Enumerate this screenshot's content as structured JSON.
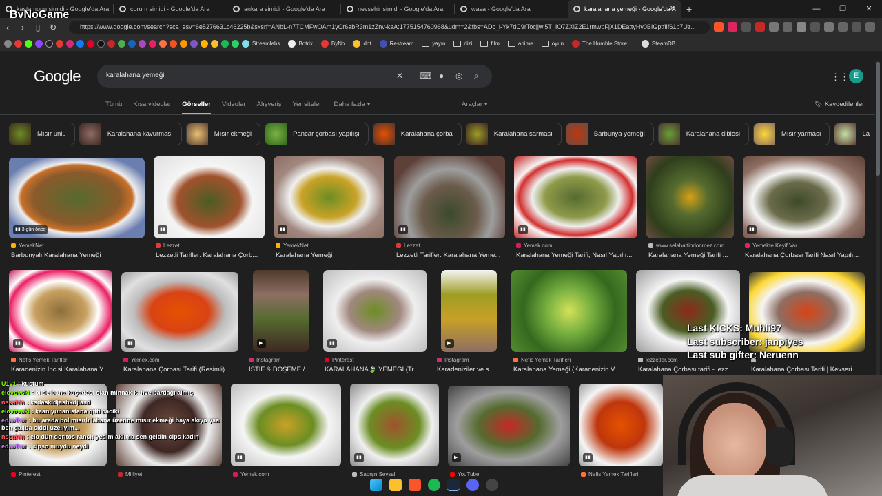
{
  "browser": {
    "tabs": [
      {
        "label": "kastamonu simidi - Google'da Ara",
        "active": false
      },
      {
        "label": "çorum simidi - Google'da Ara",
        "active": false
      },
      {
        "label": "ankara simidi - Google'da Ara",
        "active": false
      },
      {
        "label": "nevsehir simidi - Google'da Ara",
        "active": false
      },
      {
        "label": "wasa - Google'da Ara",
        "active": false
      },
      {
        "label": "karalahana yemeği - Google'da A",
        "active": true
      }
    ],
    "url": "https://www.google.com/search?sca_esv=6e5276631c46225b&sxsrf=ANbL-n7TCMFwOAm1yCr6abR3m1zZnv-kaA:1775154760968&udm=2&fbs=ADc_l-Yk7dC9rTocjjwl5T_IO7ZXiZ2E1rmwpFjX1DEattyHv0BIGptfiIf61p7Uz...",
    "bookmarks": [
      "Streamlabs",
      "Botrix",
      "ByNo",
      "dnt",
      "Restream",
      "yayın",
      "dizi",
      "film",
      "anime",
      "oyun",
      "The Humble Store:...",
      "SteamDB"
    ]
  },
  "overlay": {
    "logo": "ByNoGame",
    "kicks": "Last KICKS: Muhli97",
    "subscriber": "Last subscriber: janpiyes",
    "gifter": "Last sub gifter: Neruenn"
  },
  "google": {
    "logo": "Google",
    "query": "karalahana yemeği",
    "avatar": "E",
    "tabs": [
      "Tümü",
      "Kısa videolar",
      "Görseller",
      "Videolar",
      "Alışveriş",
      "Yer siteleri",
      "Daha fazla"
    ],
    "tools": "Araçlar",
    "saved": "Kaydedilenler",
    "chips": [
      "Mısır unlu",
      "Karalahana kavurması",
      "Mısır ekmeği",
      "Pancar çorbası yapılışı",
      "Karalahana çorba",
      "Karalahana sarması",
      "Barbunya yemeği",
      "Karalahana diblesi",
      "Mısır yarması",
      "Lahana"
    ]
  },
  "results_row1": [
    {
      "source": "YemekNet",
      "title": "Barbunyalı Karalahana Yemeği",
      "badge": "3 gün önce"
    },
    {
      "source": "Lezzet",
      "title": "Lezzetli Tarifler: Karalahana Çorb...",
      "badge": ""
    },
    {
      "source": "YemekNet",
      "title": "Karalahana Yemeği",
      "badge": ""
    },
    {
      "source": "Lezzet",
      "title": "Lezzetli Tarifler: Karalahana Yeme...",
      "badge": ""
    },
    {
      "source": "Yemek.com",
      "title": "Karalahana Yemeği Tarifi, Nasıl Yapılır...",
      "badge": ""
    },
    {
      "source": "www.selahattindonmez.com",
      "title": "Karalahana Yemeği Tarifi ...",
      "badge": ""
    },
    {
      "source": "Yemekte Keyif Var",
      "title": "Karalahana Çorbası Tarifi Nasıl Yapılı...",
      "badge": ""
    }
  ],
  "results_row2": [
    {
      "source": "Nefis Yemek Tarifleri",
      "title": "Karadenizin İncisi Karalahana Y..."
    },
    {
      "source": "Yemek.com",
      "title": "Karalahana Çorbası Tarifi (Resimli) ..."
    },
    {
      "source": "Instagram",
      "title": "İSTİF & DÖŞEME /..."
    },
    {
      "source": "Pinterest",
      "title": "KARALAHANA🍃 YEMEĞİ (Tr..."
    },
    {
      "source": "Instagram",
      "title": "Karadeniziler ve s..."
    },
    {
      "source": "Nefis Yemek Tarifleri",
      "title": "Karalahana Yemeği (Karadenizin V..."
    },
    {
      "source": "lezzetler.com",
      "title": "Karalahana Çorbası tarifi - lezz..."
    },
    {
      "source": "",
      "title": "Karalahana Çorbası Tarifi | Kevseri..."
    }
  ],
  "results_row3": [
    {
      "source": "Pinterest"
    },
    {
      "source": "Milliyet"
    },
    {
      "source": "Yemek.com"
    },
    {
      "source": "Sabrşn Sevsal"
    },
    {
      "source": "YouTube"
    },
    {
      "source": "Nefis Yemek Tarifleri"
    }
  ],
  "chat": [
    {
      "user": "U1v1",
      "msg": "kustum"
    },
    {
      "user": "elovovski",
      "msg": "bi de bana kuşadası olan minnak kahve bardağı almış"
    },
    {
      "user": "nssahin",
      "msg": "ksdaskldjashkdjlasd"
    },
    {
      "user": "elovovski",
      "msg": "kaan yunanistana gitti caciki"
    },
    {
      "user": "edaslhsr",
      "msg": "bu arada bol mısırlı lahana üzerine mısır ekmeği baya akıyo yaa ben galiba ciddi uzeliyim..."
    },
    {
      "user": "nssahin",
      "msg": "elo dün doritos ranch yedim aklıma sen geldin cips kadın"
    },
    {
      "user": "edaslhsr",
      "msg": "cipso muydu neydi"
    }
  ]
}
